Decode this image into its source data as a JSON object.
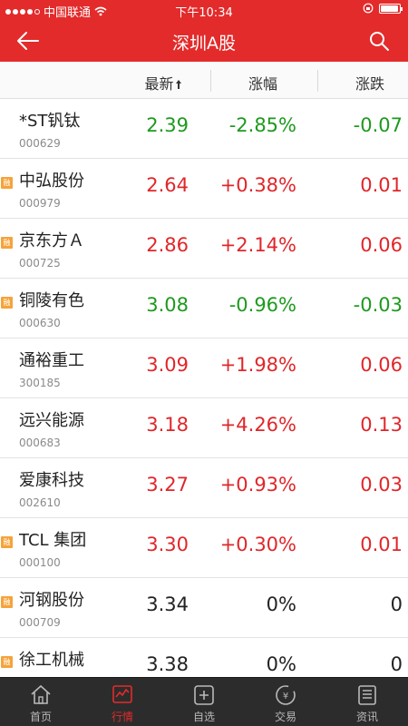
{
  "status": {
    "carrier": "中国联通",
    "time": "下午10:34",
    "battery_level": 0.95
  },
  "nav": {
    "title": "深圳A股"
  },
  "columns": {
    "latest": "最新",
    "pct": "涨幅",
    "change": "涨跌"
  },
  "badge_label": "融",
  "stocks": [
    {
      "name": "*ST钒钛",
      "code": "000629",
      "price": "2.39",
      "pct": "-2.85%",
      "change": "-0.07",
      "trend": "down",
      "margin": false
    },
    {
      "name": "中弘股份",
      "code": "000979",
      "price": "2.64",
      "pct": "+0.38%",
      "change": "0.01",
      "trend": "up",
      "margin": true
    },
    {
      "name": "京东方Ａ",
      "code": "000725",
      "price": "2.86",
      "pct": "+2.14%",
      "change": "0.06",
      "trend": "up",
      "margin": true
    },
    {
      "name": "铜陵有色",
      "code": "000630",
      "price": "3.08",
      "pct": "-0.96%",
      "change": "-0.03",
      "trend": "down",
      "margin": true
    },
    {
      "name": "通裕重工",
      "code": "300185",
      "price": "3.09",
      "pct": "+1.98%",
      "change": "0.06",
      "trend": "up",
      "margin": false
    },
    {
      "name": "远兴能源",
      "code": "000683",
      "price": "3.18",
      "pct": "+4.26%",
      "change": "0.13",
      "trend": "up",
      "margin": false
    },
    {
      "name": "爱康科技",
      "code": "002610",
      "price": "3.27",
      "pct": "+0.93%",
      "change": "0.03",
      "trend": "up",
      "margin": false
    },
    {
      "name": "TCL 集团",
      "code": "000100",
      "price": "3.30",
      "pct": "+0.30%",
      "change": "0.01",
      "trend": "up",
      "margin": true
    },
    {
      "name": "河钢股份",
      "code": "000709",
      "price": "3.34",
      "pct": "0%",
      "change": "0",
      "trend": "flat",
      "margin": true
    },
    {
      "name": "徐工机械",
      "code": "",
      "price": "3.38",
      "pct": "0%",
      "change": "0",
      "trend": "flat",
      "margin": true
    }
  ],
  "tabs": [
    {
      "label": "首页",
      "icon": "home-icon",
      "active": false
    },
    {
      "label": "行情",
      "icon": "market-chart-icon",
      "active": true
    },
    {
      "label": "自选",
      "icon": "watchlist-icon",
      "active": false
    },
    {
      "label": "交易",
      "icon": "trade-icon",
      "active": false
    },
    {
      "label": "资讯",
      "icon": "news-icon",
      "active": false
    }
  ],
  "colors": {
    "brand_red": "#e32b2b",
    "up": "#e0262a",
    "down": "#1d9a1d",
    "margin_badge": "#f5a33a"
  }
}
